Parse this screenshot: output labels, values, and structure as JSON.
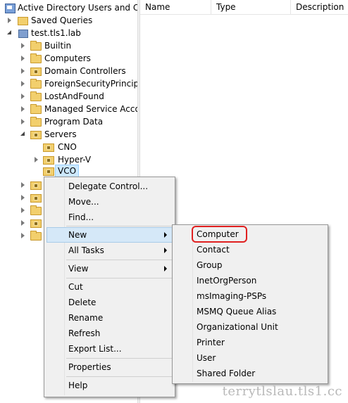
{
  "tree": {
    "root": "Active Directory Users and Computers",
    "saved_queries": "Saved Queries",
    "domain": "test.tls1.lab",
    "builtin": "Builtin",
    "computers": "Computers",
    "domain_controllers": "Domain Controllers",
    "foreign_security_principals": "ForeignSecurityPrincipals",
    "lost_and_found": "LostAndFound",
    "managed_service_accounts": "Managed Service Accounts",
    "program_data": "Program Data",
    "servers": "Servers",
    "cno": "CNO",
    "hyper_v": "Hyper-V",
    "vco": "VCO"
  },
  "list": {
    "columns": [
      "Name",
      "Type",
      "Description"
    ]
  },
  "context_menu": {
    "items": [
      "Delegate Control...",
      "Move...",
      "Find...",
      "New",
      "All Tasks",
      "View",
      "Cut",
      "Delete",
      "Rename",
      "Refresh",
      "Export List...",
      "Properties",
      "Help"
    ]
  },
  "new_submenu": {
    "items": [
      "Computer",
      "Contact",
      "Group",
      "InetOrgPerson",
      "msImaging-PSPs",
      "MSMQ Queue Alias",
      "Organizational Unit",
      "Printer",
      "User",
      "Shared Folder"
    ]
  },
  "watermark": "terrytlslau.tls1.cc",
  "colors": {
    "highlight": "#d5e8f8",
    "selection": "#cce8ff",
    "annotation": "#e02020"
  }
}
